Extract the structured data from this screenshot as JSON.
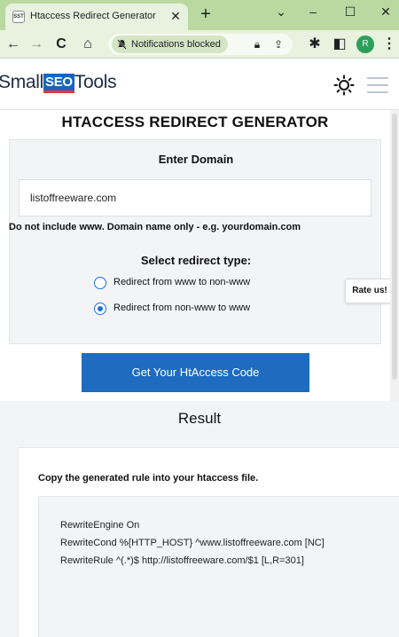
{
  "browser": {
    "tab_title": "Htaccess Redirect Generator",
    "favicon_text": "SST",
    "notification_pill": "Notifications blocked",
    "profile_initial": "R"
  },
  "site": {
    "logo_prefix": "Small",
    "logo_seo": "SEO",
    "logo_suffix": "Tools"
  },
  "tool": {
    "page_title": "HTACCESS REDIRECT GENERATOR",
    "domain_heading": "Enter Domain",
    "domain_value": "listoffreeware.com",
    "hint": "Do not include www. Domain name only - e.g. yourdomain.com",
    "redirect_heading": "Select redirect type:",
    "options": [
      {
        "label": "Redirect from www to non-www",
        "checked": false
      },
      {
        "label": "Redirect from non-www to www",
        "checked": true
      }
    ],
    "submit_label": "Get Your HtAccess Code",
    "rate_label": "Rate us!"
  },
  "result": {
    "title": "Result",
    "instruction": "Copy the generated rule into your htaccess file.",
    "code_lines": [
      "RewriteEngine On",
      "RewriteCond %{HTTP_HOST} ^www.listoffreeware.com [NC]",
      "RewriteRule ^(.*)$ http://listoffreeware.com/$1 [L,R=301]"
    ]
  },
  "colors": {
    "chrome_tabstrip": "#b9d9a0",
    "chrome_toolbar": "#e8f2df",
    "primary_button": "#1e6bbf",
    "radio_accent": "#1a73e8",
    "logo_blue": "#1565c0",
    "logo_red": "#e53935"
  },
  "icons": [
    "favicon-icon",
    "close-icon",
    "plus-icon",
    "minimize-icon",
    "restore-icon",
    "window-close-icon",
    "back-arrow-icon",
    "forward-arrow-icon",
    "reload-icon",
    "home-icon",
    "bell-off-icon",
    "lock-icon",
    "share-icon",
    "puzzle-icon",
    "sidepanel-icon",
    "more-vert-icon",
    "sun-icon",
    "hamburger-icon"
  ]
}
